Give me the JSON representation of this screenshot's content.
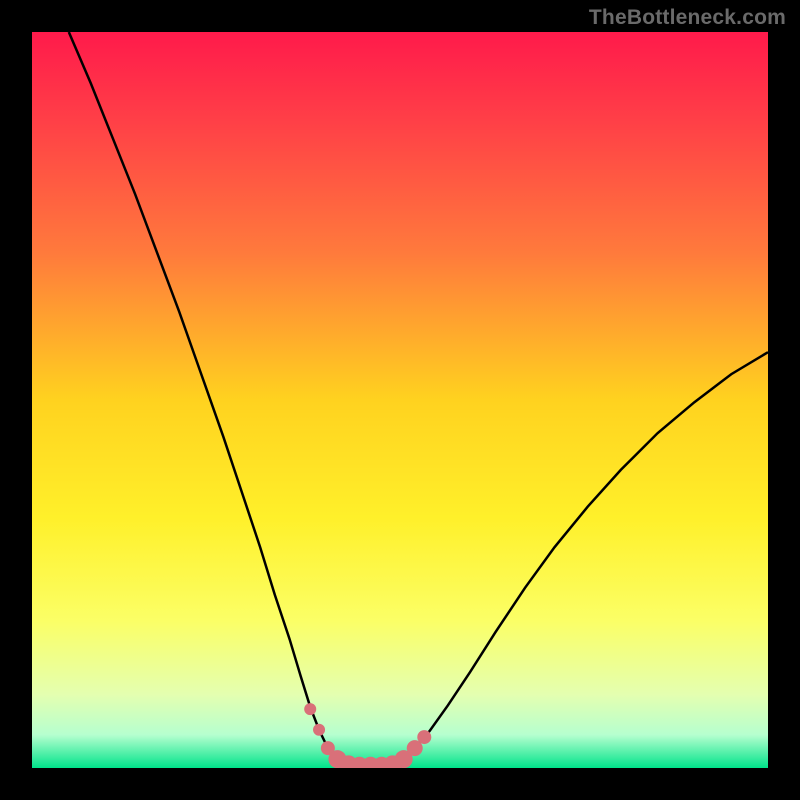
{
  "watermark": "TheBottleneck.com",
  "chart_data": {
    "type": "line",
    "title": "",
    "xlabel": "",
    "ylabel": "",
    "xlim": [
      0,
      1
    ],
    "ylim": [
      0,
      1
    ],
    "gradient_stops": [
      {
        "offset": 0.0,
        "color": "#ff1a4b"
      },
      {
        "offset": 0.12,
        "color": "#ff3f47"
      },
      {
        "offset": 0.3,
        "color": "#ff7a3c"
      },
      {
        "offset": 0.5,
        "color": "#ffd21f"
      },
      {
        "offset": 0.66,
        "color": "#fff02a"
      },
      {
        "offset": 0.8,
        "color": "#fbff66"
      },
      {
        "offset": 0.9,
        "color": "#e4ffb0"
      },
      {
        "offset": 0.955,
        "color": "#b6ffcf"
      },
      {
        "offset": 1.0,
        "color": "#00e38a"
      }
    ],
    "series": [
      {
        "name": "bottleneck-curve",
        "stroke": "#000000",
        "stroke_width": 2.5,
        "points": [
          {
            "x": 0.05,
            "y": 1.0
          },
          {
            "x": 0.08,
            "y": 0.93
          },
          {
            "x": 0.11,
            "y": 0.855
          },
          {
            "x": 0.14,
            "y": 0.78
          },
          {
            "x": 0.17,
            "y": 0.7
          },
          {
            "x": 0.2,
            "y": 0.62
          },
          {
            "x": 0.23,
            "y": 0.535
          },
          {
            "x": 0.26,
            "y": 0.45
          },
          {
            "x": 0.29,
            "y": 0.36
          },
          {
            "x": 0.31,
            "y": 0.3
          },
          {
            "x": 0.33,
            "y": 0.235
          },
          {
            "x": 0.35,
            "y": 0.175
          },
          {
            "x": 0.365,
            "y": 0.125
          },
          {
            "x": 0.378,
            "y": 0.083
          },
          {
            "x": 0.39,
            "y": 0.052
          },
          {
            "x": 0.402,
            "y": 0.027
          },
          {
            "x": 0.415,
            "y": 0.012
          },
          {
            "x": 0.43,
            "y": 0.005
          },
          {
            "x": 0.45,
            "y": 0.003
          },
          {
            "x": 0.47,
            "y": 0.003
          },
          {
            "x": 0.49,
            "y": 0.005
          },
          {
            "x": 0.505,
            "y": 0.012
          },
          {
            "x": 0.52,
            "y": 0.027
          },
          {
            "x": 0.54,
            "y": 0.05
          },
          {
            "x": 0.565,
            "y": 0.085
          },
          {
            "x": 0.595,
            "y": 0.13
          },
          {
            "x": 0.63,
            "y": 0.185
          },
          {
            "x": 0.67,
            "y": 0.245
          },
          {
            "x": 0.71,
            "y": 0.3
          },
          {
            "x": 0.755,
            "y": 0.355
          },
          {
            "x": 0.8,
            "y": 0.405
          },
          {
            "x": 0.85,
            "y": 0.455
          },
          {
            "x": 0.9,
            "y": 0.497
          },
          {
            "x": 0.95,
            "y": 0.535
          },
          {
            "x": 1.0,
            "y": 0.565
          }
        ]
      }
    ],
    "markers": {
      "name": "bottom-markers",
      "fill": "#d97079",
      "radius_small": 6,
      "radius_large": 9,
      "points": [
        {
          "x": 0.378,
          "y": 0.08,
          "r": 6
        },
        {
          "x": 0.39,
          "y": 0.052,
          "r": 6
        },
        {
          "x": 0.402,
          "y": 0.027,
          "r": 7
        },
        {
          "x": 0.415,
          "y": 0.012,
          "r": 9
        },
        {
          "x": 0.43,
          "y": 0.005,
          "r": 9
        },
        {
          "x": 0.445,
          "y": 0.003,
          "r": 9
        },
        {
          "x": 0.46,
          "y": 0.003,
          "r": 9
        },
        {
          "x": 0.475,
          "y": 0.003,
          "r": 9
        },
        {
          "x": 0.49,
          "y": 0.005,
          "r": 9
        },
        {
          "x": 0.505,
          "y": 0.012,
          "r": 9
        },
        {
          "x": 0.52,
          "y": 0.027,
          "r": 8
        },
        {
          "x": 0.533,
          "y": 0.042,
          "r": 7
        }
      ]
    }
  }
}
